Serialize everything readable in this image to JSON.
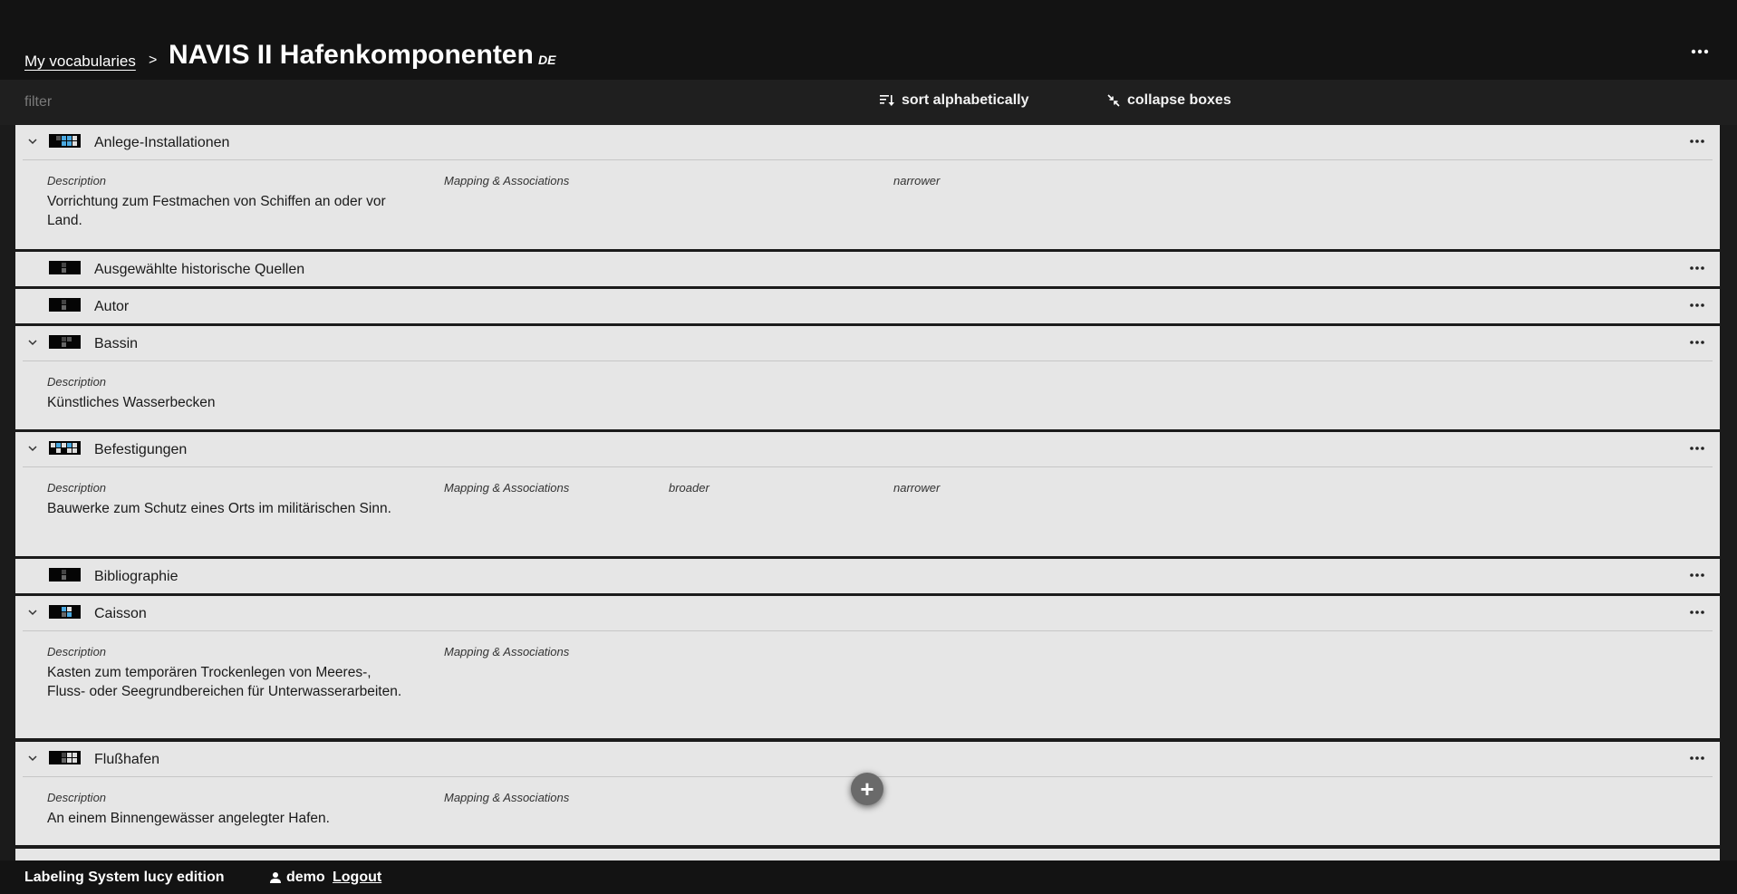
{
  "header": {
    "breadcrumb_link": "My vocabularies",
    "breadcrumb_separator": ">",
    "title": "NAVIS II Hafenkomponenten",
    "language": "DE"
  },
  "toolbar": {
    "filter_placeholder": "filter",
    "sort_label": "sort alphabetically",
    "collapse_label": "collapse boxes"
  },
  "concepts": [
    {
      "title": "Anlege-Installationen",
      "description_label": "Description",
      "description": "Vorrichtung zum Festmachen von Schiffen an oder vor Land.",
      "mapping_label": "Mapping & Associations",
      "narrower_label": "narrower"
    },
    {
      "title": "Ausgewählte historische Quellen"
    },
    {
      "title": "Autor"
    },
    {
      "title": "Bassin",
      "description_label": "Description",
      "description": "Künstliches Wasserbecken"
    },
    {
      "title": "Befestigungen",
      "description_label": "Description",
      "description": "Bauwerke zum Schutz eines Orts im militärischen Sinn.",
      "mapping_label": "Mapping & Associations",
      "broader_label": "broader",
      "narrower_label": "narrower"
    },
    {
      "title": "Bibliographie"
    },
    {
      "title": "Caisson",
      "description_label": "Description",
      "description": "Kasten zum temporären Trockenlegen von Meeres-, Fluss- oder Seegrundbereichen für Unterwasserarbeiten.",
      "mapping_label": "Mapping & Associations"
    },
    {
      "title": "Flußhafen",
      "description_label": "Description",
      "description": "An einem Binnengewässer angelegter Hafen.",
      "mapping_label": "Mapping & Associations"
    }
  ],
  "fab_label": "+",
  "footer": {
    "app_name": "Labeling System lucy edition",
    "user": "demo",
    "logout": "Logout"
  },
  "colors": {
    "background": "#1b1b1b",
    "header": "#131313",
    "card": "#e6e6e6",
    "thumb_accent": "#4aa8e0"
  }
}
